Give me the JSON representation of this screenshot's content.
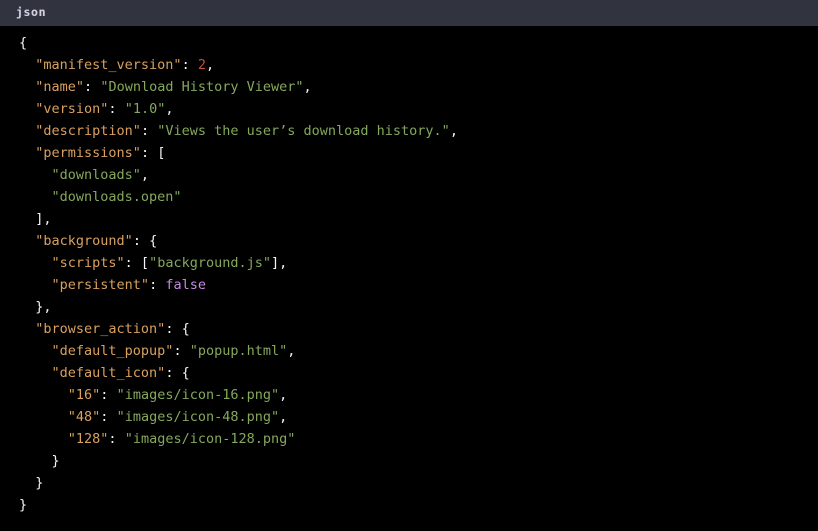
{
  "header": {
    "language_label": "json",
    "background_color": "#31333f",
    "text_color": "#cfd2da"
  },
  "editor": {
    "background_color": "#000000",
    "token_colors": {
      "punctuation": "#f5f5f5",
      "key": "#d9a05f",
      "string": "#84a85c",
      "number": "#c1503c",
      "boolean": "#c48be0"
    }
  },
  "code": {
    "language": "json",
    "lines": [
      {
        "indent": 0,
        "tokens": [
          {
            "t": "punct",
            "v": "{"
          }
        ]
      },
      {
        "indent": 1,
        "tokens": [
          {
            "t": "key",
            "v": "\"manifest_version\""
          },
          {
            "t": "punct",
            "v": ": "
          },
          {
            "t": "num",
            "v": "2"
          },
          {
            "t": "punct",
            "v": ","
          }
        ]
      },
      {
        "indent": 1,
        "tokens": [
          {
            "t": "key",
            "v": "\"name\""
          },
          {
            "t": "punct",
            "v": ": "
          },
          {
            "t": "str",
            "v": "\"Download History Viewer\""
          },
          {
            "t": "punct",
            "v": ","
          }
        ]
      },
      {
        "indent": 1,
        "tokens": [
          {
            "t": "key",
            "v": "\"version\""
          },
          {
            "t": "punct",
            "v": ": "
          },
          {
            "t": "str",
            "v": "\"1.0\""
          },
          {
            "t": "punct",
            "v": ","
          }
        ]
      },
      {
        "indent": 1,
        "tokens": [
          {
            "t": "key",
            "v": "\"description\""
          },
          {
            "t": "punct",
            "v": ": "
          },
          {
            "t": "str",
            "v": "\"Views the user’s download history.\""
          },
          {
            "t": "punct",
            "v": ","
          }
        ]
      },
      {
        "indent": 1,
        "tokens": [
          {
            "t": "key",
            "v": "\"permissions\""
          },
          {
            "t": "punct",
            "v": ": ["
          }
        ]
      },
      {
        "indent": 2,
        "tokens": [
          {
            "t": "str",
            "v": "\"downloads\""
          },
          {
            "t": "punct",
            "v": ","
          }
        ]
      },
      {
        "indent": 2,
        "tokens": [
          {
            "t": "str",
            "v": "\"downloads.open\""
          }
        ]
      },
      {
        "indent": 1,
        "tokens": [
          {
            "t": "punct",
            "v": "],"
          }
        ]
      },
      {
        "indent": 1,
        "tokens": [
          {
            "t": "key",
            "v": "\"background\""
          },
          {
            "t": "punct",
            "v": ": {"
          }
        ]
      },
      {
        "indent": 2,
        "tokens": [
          {
            "t": "key",
            "v": "\"scripts\""
          },
          {
            "t": "punct",
            "v": ": ["
          },
          {
            "t": "str",
            "v": "\"background.js\""
          },
          {
            "t": "punct",
            "v": "],"
          }
        ]
      },
      {
        "indent": 2,
        "tokens": [
          {
            "t": "key",
            "v": "\"persistent\""
          },
          {
            "t": "punct",
            "v": ": "
          },
          {
            "t": "bool",
            "v": "false"
          }
        ]
      },
      {
        "indent": 1,
        "tokens": [
          {
            "t": "punct",
            "v": "},"
          }
        ]
      },
      {
        "indent": 1,
        "tokens": [
          {
            "t": "key",
            "v": "\"browser_action\""
          },
          {
            "t": "punct",
            "v": ": {"
          }
        ]
      },
      {
        "indent": 2,
        "tokens": [
          {
            "t": "key",
            "v": "\"default_popup\""
          },
          {
            "t": "punct",
            "v": ": "
          },
          {
            "t": "str",
            "v": "\"popup.html\""
          },
          {
            "t": "punct",
            "v": ","
          }
        ]
      },
      {
        "indent": 2,
        "tokens": [
          {
            "t": "key",
            "v": "\"default_icon\""
          },
          {
            "t": "punct",
            "v": ": {"
          }
        ]
      },
      {
        "indent": 3,
        "tokens": [
          {
            "t": "key",
            "v": "\"16\""
          },
          {
            "t": "punct",
            "v": ": "
          },
          {
            "t": "str",
            "v": "\"images/icon-16.png\""
          },
          {
            "t": "punct",
            "v": ","
          }
        ]
      },
      {
        "indent": 3,
        "tokens": [
          {
            "t": "key",
            "v": "\"48\""
          },
          {
            "t": "punct",
            "v": ": "
          },
          {
            "t": "str",
            "v": "\"images/icon-48.png\""
          },
          {
            "t": "punct",
            "v": ","
          }
        ]
      },
      {
        "indent": 3,
        "tokens": [
          {
            "t": "key",
            "v": "\"128\""
          },
          {
            "t": "punct",
            "v": ": "
          },
          {
            "t": "str",
            "v": "\"images/icon-128.png\""
          }
        ]
      },
      {
        "indent": 2,
        "tokens": [
          {
            "t": "punct",
            "v": "}"
          }
        ]
      },
      {
        "indent": 1,
        "tokens": [
          {
            "t": "punct",
            "v": "}"
          }
        ]
      },
      {
        "indent": 0,
        "tokens": [
          {
            "t": "punct",
            "v": "}"
          }
        ]
      }
    ]
  }
}
